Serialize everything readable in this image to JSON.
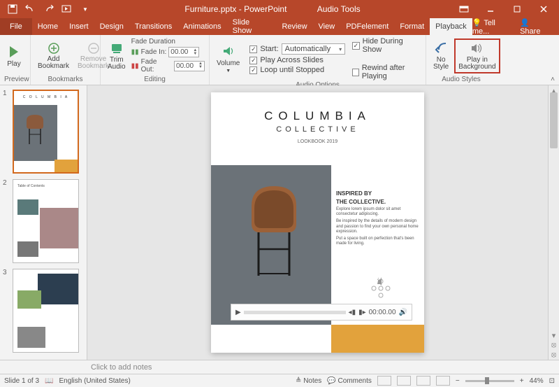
{
  "title_bar": {
    "filename": "Furniture.pptx - PowerPoint",
    "context_tools": "Audio Tools"
  },
  "menu": {
    "file": "File",
    "home": "Home",
    "insert": "Insert",
    "design": "Design",
    "transitions": "Transitions",
    "animations": "Animations",
    "slideshow": "Slide Show",
    "review": "Review",
    "view": "View",
    "pdf": "PDFelement",
    "format": "Format",
    "playback": "Playback",
    "tellme": "Tell me...",
    "share": "Share"
  },
  "ribbon": {
    "play": "Play",
    "preview_label": "Preview",
    "add_bookmark": "Add\nBookmark",
    "remove_bookmark": "Remove\nBookmark",
    "bookmarks_label": "Bookmarks",
    "trim_audio": "Trim\nAudio",
    "fade_duration": "Fade Duration",
    "fade_in": "Fade In:",
    "fade_out": "Fade Out:",
    "fade_in_val": "00.00",
    "fade_out_val": "00.00",
    "editing_label": "Editing",
    "volume": "Volume",
    "start_label": "Start:",
    "start_value": "Automatically",
    "play_across": "Play Across Slides",
    "loop": "Loop until Stopped",
    "hide_during": "Hide During Show",
    "rewind": "Rewind after Playing",
    "audio_options_label": "Audio Options",
    "no_style": "No\nStyle",
    "play_bg": "Play in\nBackground",
    "audio_styles_label": "Audio Styles"
  },
  "thumbs": {
    "n1": "1",
    "n2": "2",
    "n3": "3",
    "toc": "Table of Contents"
  },
  "slide": {
    "title": "COLUMBIA",
    "subtitle": "COLLECTIVE",
    "lookbook": "LOOKBOOK 2019",
    "h1": "INSPIRED BY",
    "h2": "THE COLLECTIVE.",
    "p1": "Explore lorem ipsum dolor sit amet consectetur adipiscing.",
    "p2": "Be inspired by the details of modern design and passion to find your own personal home expression.",
    "p3": "Put a space built on perfection that's been made for living.",
    "audio_time": "00:00.00"
  },
  "notes": {
    "placeholder": "Click to add notes"
  },
  "status": {
    "slide_count": "Slide 1 of 3",
    "lang": "English (United States)",
    "notes": "Notes",
    "comments": "Comments",
    "zoom": "44%"
  }
}
